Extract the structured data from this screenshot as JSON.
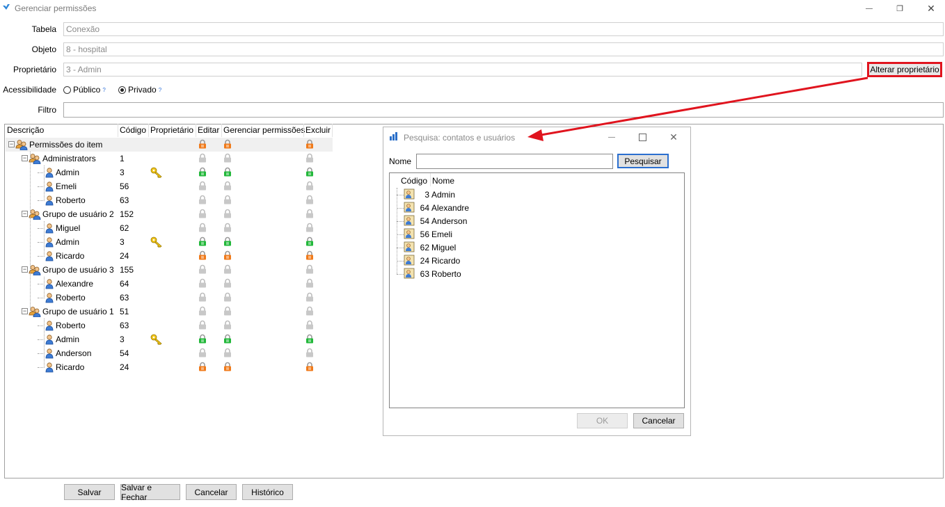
{
  "window": {
    "title": "Gerenciar permissões",
    "controls": {
      "minimize": "—",
      "restore": "❐",
      "close": "✕"
    }
  },
  "form": {
    "tabela_label": "Tabela",
    "tabela_value": "Conexão",
    "objeto_label": "Objeto",
    "objeto_value": "8 - hospital",
    "proprietario_label": "Proprietário",
    "proprietario_value": "3 - Admin",
    "alterar_button": "Alterar proprietário",
    "acessibilidade_label": "Acessibilidade",
    "publico_label": "Público",
    "privado_label": "Privado",
    "selected_accessibility": "Privado",
    "filtro_label": "Filtro",
    "filtro_value": ""
  },
  "tree": {
    "columns": [
      "Descrição",
      "Código",
      "Proprietário",
      "Editar",
      "Gerenciar permissões",
      "Excluir"
    ],
    "rows": [
      {
        "label": "Permissões do item",
        "code": "",
        "level": 0,
        "type": "group",
        "owner": false,
        "editar": "orange",
        "gerenciar": "orange",
        "excluir": "orange",
        "selected": true
      },
      {
        "label": "Administrators",
        "code": "1",
        "level": 1,
        "type": "group",
        "owner": false,
        "editar": "gray",
        "gerenciar": "gray",
        "excluir": "gray"
      },
      {
        "label": "Admin",
        "code": "3",
        "level": 2,
        "type": "user",
        "owner": true,
        "editar": "green",
        "gerenciar": "green",
        "excluir": "green"
      },
      {
        "label": "Emeli",
        "code": "56",
        "level": 2,
        "type": "user",
        "owner": false,
        "editar": "gray",
        "gerenciar": "gray",
        "excluir": "gray"
      },
      {
        "label": "Roberto",
        "code": "63",
        "level": 2,
        "type": "user",
        "owner": false,
        "editar": "gray",
        "gerenciar": "gray",
        "excluir": "gray"
      },
      {
        "label": "Grupo de usuário 2",
        "code": "152",
        "level": 1,
        "type": "group",
        "owner": false,
        "editar": "gray",
        "gerenciar": "gray",
        "excluir": "gray"
      },
      {
        "label": "Miguel",
        "code": "62",
        "level": 2,
        "type": "user",
        "owner": false,
        "editar": "gray",
        "gerenciar": "gray",
        "excluir": "gray"
      },
      {
        "label": "Admin",
        "code": "3",
        "level": 2,
        "type": "user",
        "owner": true,
        "editar": "green",
        "gerenciar": "green",
        "excluir": "green"
      },
      {
        "label": "Ricardo",
        "code": "24",
        "level": 2,
        "type": "user",
        "owner": false,
        "editar": "orange",
        "gerenciar": "orange",
        "excluir": "orange"
      },
      {
        "label": "Grupo de usuário 3",
        "code": "155",
        "level": 1,
        "type": "group",
        "owner": false,
        "editar": "gray",
        "gerenciar": "gray",
        "excluir": "gray"
      },
      {
        "label": "Alexandre",
        "code": "64",
        "level": 2,
        "type": "user",
        "owner": false,
        "editar": "gray",
        "gerenciar": "gray",
        "excluir": "gray"
      },
      {
        "label": "Roberto",
        "code": "63",
        "level": 2,
        "type": "user",
        "owner": false,
        "editar": "gray",
        "gerenciar": "gray",
        "excluir": "gray"
      },
      {
        "label": "Grupo de usuário 1",
        "code": "51",
        "level": 1,
        "type": "group",
        "owner": false,
        "editar": "gray",
        "gerenciar": "gray",
        "excluir": "gray"
      },
      {
        "label": "Roberto",
        "code": "63",
        "level": 2,
        "type": "user",
        "owner": false,
        "editar": "gray",
        "gerenciar": "gray",
        "excluir": "gray"
      },
      {
        "label": "Admin",
        "code": "3",
        "level": 2,
        "type": "user",
        "owner": true,
        "editar": "green",
        "gerenciar": "green",
        "excluir": "green"
      },
      {
        "label": "Anderson",
        "code": "54",
        "level": 2,
        "type": "user",
        "owner": false,
        "editar": "gray",
        "gerenciar": "gray",
        "excluir": "gray"
      },
      {
        "label": "Ricardo",
        "code": "24",
        "level": 2,
        "type": "user",
        "owner": false,
        "editar": "orange",
        "gerenciar": "orange",
        "excluir": "orange"
      }
    ]
  },
  "dialog": {
    "title": "Pesquisa: contatos e usuários",
    "nome_label": "Nome",
    "nome_value": "",
    "pesquisar_button": "Pesquisar",
    "columns": [
      "Código",
      "Nome"
    ],
    "results": [
      {
        "code": "3",
        "name": "Admin"
      },
      {
        "code": "64",
        "name": "Alexandre"
      },
      {
        "code": "54",
        "name": "Anderson"
      },
      {
        "code": "56",
        "name": "Emeli"
      },
      {
        "code": "62",
        "name": "Miguel"
      },
      {
        "code": "24",
        "name": "Ricardo"
      },
      {
        "code": "63",
        "name": "Roberto"
      }
    ],
    "ok_button": "OK",
    "cancelar_button": "Cancelar"
  },
  "footer": {
    "salvar": "Salvar",
    "salvar_fechar": "Salvar e Fechar",
    "cancelar": "Cancelar",
    "historico": "Histórico"
  },
  "colors": {
    "lock_gray": "#c8c8c8",
    "lock_orange": "#f07a1a",
    "lock_green": "#22b83a",
    "annotation_red": "#e0141e",
    "dialog_button_border": "#2b6fcf"
  },
  "icons": {
    "app": "blue-check-icon",
    "owner": "key-icon",
    "group": "users-group-icon",
    "user": "user-icon",
    "dialog": "bar-chart-icon"
  }
}
